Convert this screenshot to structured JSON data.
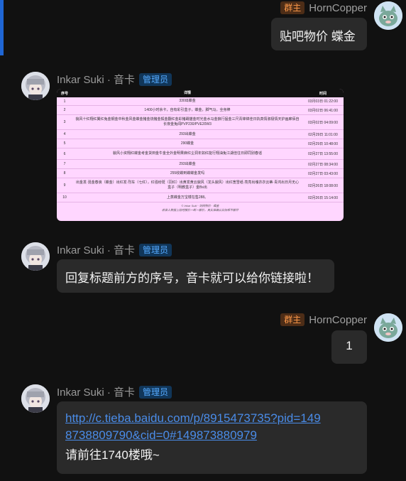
{
  "messages": [
    {
      "user": "HornCopper",
      "badge": "群主",
      "text": "贴吧物价 蝶金"
    },
    {
      "user": "Inkar Suki · 音卡",
      "badge": "管理员",
      "type": "image",
      "table": {
        "headers": [
          "序号",
          "详情",
          "时间"
        ],
        "rows": [
          [
            "1",
            "330出蝶金",
            "03月03日 01:22:00"
          ],
          [
            "2",
            "1400小时余卡，自有彩引盒子，蝶金，脚气马，全身棒",
            "03月02日 06:41:00"
          ],
          [
            "3",
            "貌风十红翔红翼红兔金钢金中秋金风金蝶金猪金烧猪金狐金翻红金彩猪踢猫金时光金水马金狼行猛金三尺青锋锦佳日执真情淑极情天护画廊佰自长夜金兔闻PVP230/PVE20W3",
            "03月02日 04:09:00"
          ],
          [
            "4",
            "293出蝶金",
            "02月29日 11:01:00"
          ],
          [
            "5",
            "290蝶金",
            "02月29日 10:48:00"
          ],
          [
            "6",
            "貌风小资翔红蝶金考金货田金牛金全外金明果麻红尘洞年如红能行翔油兔江湖佳往日即同别春谣",
            "02月27日 13:55:00"
          ],
          [
            "7",
            "293出蝶金",
            "02月27日 08:34:00"
          ],
          [
            "8",
            "255收蝶到蝶蝶金发吗",
            "02月27日 03:43:00"
          ],
          [
            "9",
            "出金发·混金春浪（蝶金）出红发·烈车（七红），红强纷斑（羽红）出黄发黄云貌风（龙头貌风）出红宽雪纸·亮亮出魂衣衣云蒂·青鸿出日月无心盒子（明教盒子）金Bs出",
            "02月26日 18:08:00"
          ],
          [
            "10",
            "上蒸蝶金万宝楼在售288。",
            "02月26日 15:14:00"
          ]
        ],
        "footer": [
          "© Inkar Suki · 剑网物价 · 蝶金",
          "收录人数据上贴吧楼价一断一都价，真实准确以实际帮不都开"
        ]
      }
    },
    {
      "user": "Inkar Suki · 音卡",
      "badge": "管理员",
      "text": "回复标题前方的序号，音卡就可以给你链接啦！"
    },
    {
      "user": "HornCopper",
      "badge": "群主",
      "text": "1"
    },
    {
      "user": "Inkar Suki · 音卡",
      "badge": "管理员",
      "link_line1": "http://c.tieba.baidu.com/p/8915473735?pid=149",
      "link_line2": "8738809790&cid=0#149873880979",
      "text": "请前往1740楼哦~"
    }
  ],
  "colors": {
    "accent": "#1f66d4",
    "bubble": "#2a2a2a",
    "owner_badge": "#ff9a4a",
    "admin_badge": "#55aaff",
    "link": "#4a8ce8",
    "image_bg": "#ffd6ff"
  }
}
